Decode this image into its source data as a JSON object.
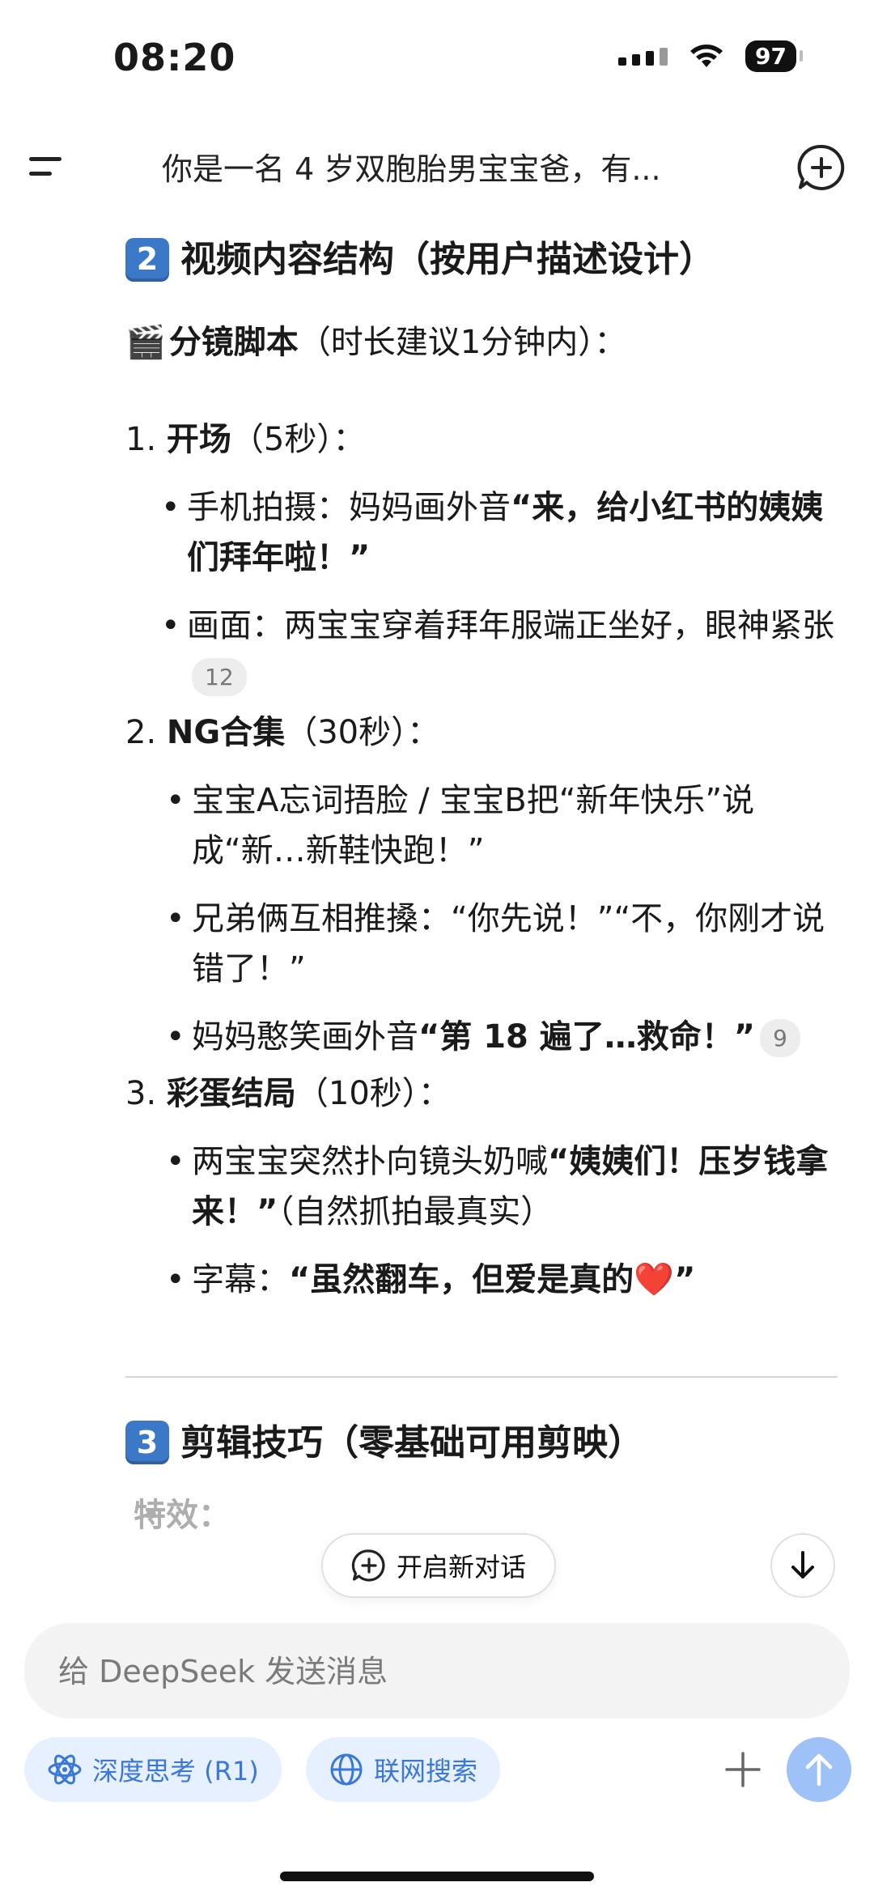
{
  "status_bar": {
    "time": "08:20",
    "battery": "97"
  },
  "nav": {
    "title": "你是一名 4 岁双胞胎男宝宝爸，有..."
  },
  "content": {
    "section2_num": "2",
    "section2_title": "视频内容结构（按用户描述设计）",
    "storyboard_label": "分镜脚本",
    "storyboard_note": "（时长建议1分钟内）：",
    "step1_num": "1.",
    "step1_title": "开场",
    "step1_time": "（5秒）：",
    "step1_b1_prefix": "手机拍摄：妈妈画外音",
    "step1_b1_bold": "“来，给小红书的姨姨们拜年啦！”",
    "step1_b2_text": "画面：两宝宝穿着拜年服端正坐好，眼神紧张",
    "step1_b2_cite": "12",
    "step2_num": "2.",
    "step2_title": "NG合集",
    "step2_time": "（30秒）：",
    "step2_b1": "宝宝A忘词捂脸 / 宝宝B把“新年快乐”说成“新…新鞋快跑！”",
    "step2_b2": "兄弟俩互相推搡：“你先说！”“不，你刚才说错了！”",
    "step2_b3_prefix": "妈妈憨笑画外音",
    "step2_b3_bold": "“第 18 遍了…救命！”",
    "step2_b3_cite": "9",
    "step3_num": "3.",
    "step3_title": "彩蛋结局",
    "step3_time": "（10秒）：",
    "step3_b1_prefix": "两宝宝突然扑向镜头奶喊",
    "step3_b1_bold": "“姨姨们！压岁钱拿来！”",
    "step3_b1_suffix": "（自然抓拍最真实）",
    "step3_b2_prefix": "字幕：",
    "step3_b2_bold": "“虽然翻车，但爱是真的",
    "step3_b2_heart": "❤️",
    "step3_b2_close": "”",
    "section3_num": "3",
    "section3_title": "剪辑技巧（零基础可用剪映）",
    "section3_item": "特效："
  },
  "floating": {
    "new_chat_label": "开启新对话"
  },
  "composer": {
    "placeholder": "给 DeepSeek 发送消息",
    "deep_think_label": "深度思考 (R1)",
    "web_search_label": "联网搜索"
  },
  "colors": {
    "accent": "#3a77d8",
    "accent_bg": "#e6f0fe",
    "send_bg": "#9ec1f7",
    "badge_blue": "#3c78c8"
  }
}
